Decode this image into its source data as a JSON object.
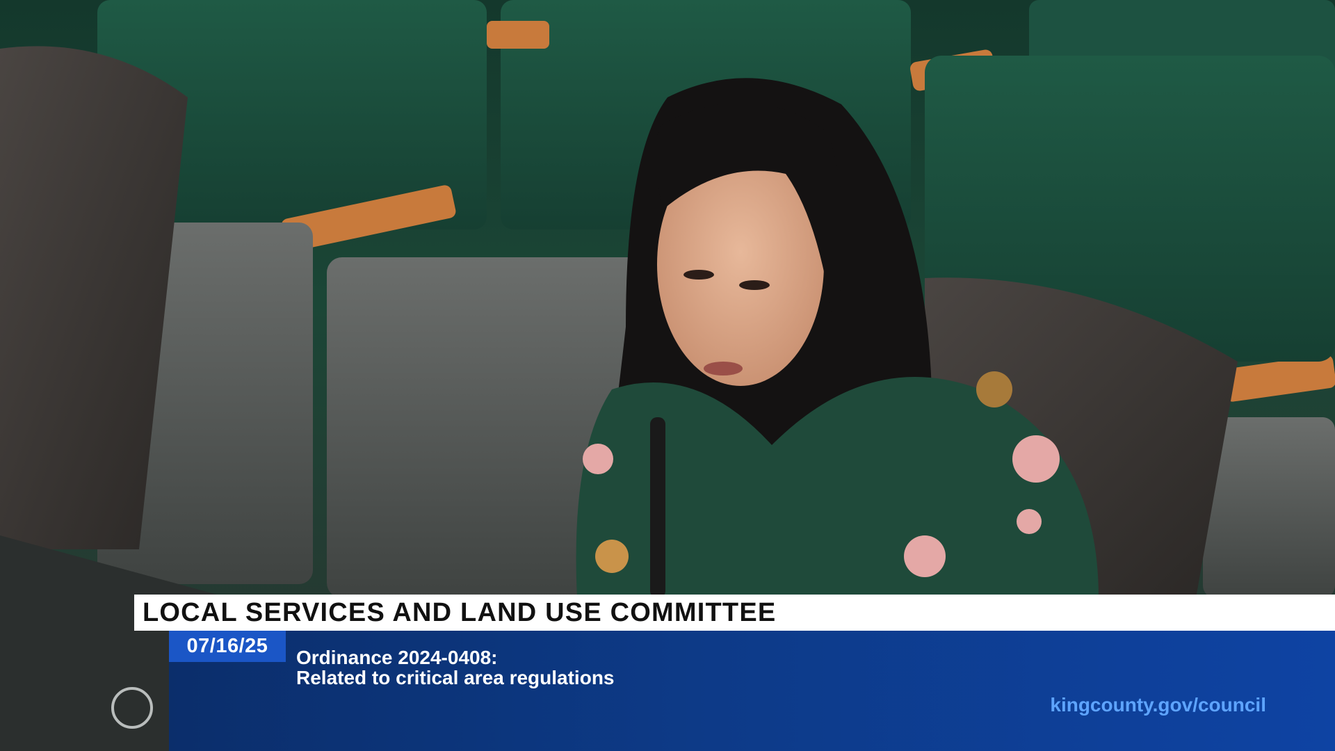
{
  "broadcast": {
    "committee_title": "LOCAL SERVICES AND LAND USE COMMITTEE",
    "date": "07/16/25",
    "item_line1": "Ordinance 2024-0408:",
    "item_line2": "Related to critical area regulations",
    "website": "kingcounty.gov/council"
  },
  "colors": {
    "title_bar_bg": "#ffffff",
    "info_bar_bg": "#0d3a87",
    "date_tab_bg": "#1b56c6",
    "url_text": "#5ea4ff"
  },
  "scene": {
    "description_icons": [
      "council-chamber-seats",
      "speaker-person",
      "microphone-icon",
      "laptop-logo-icon"
    ]
  }
}
